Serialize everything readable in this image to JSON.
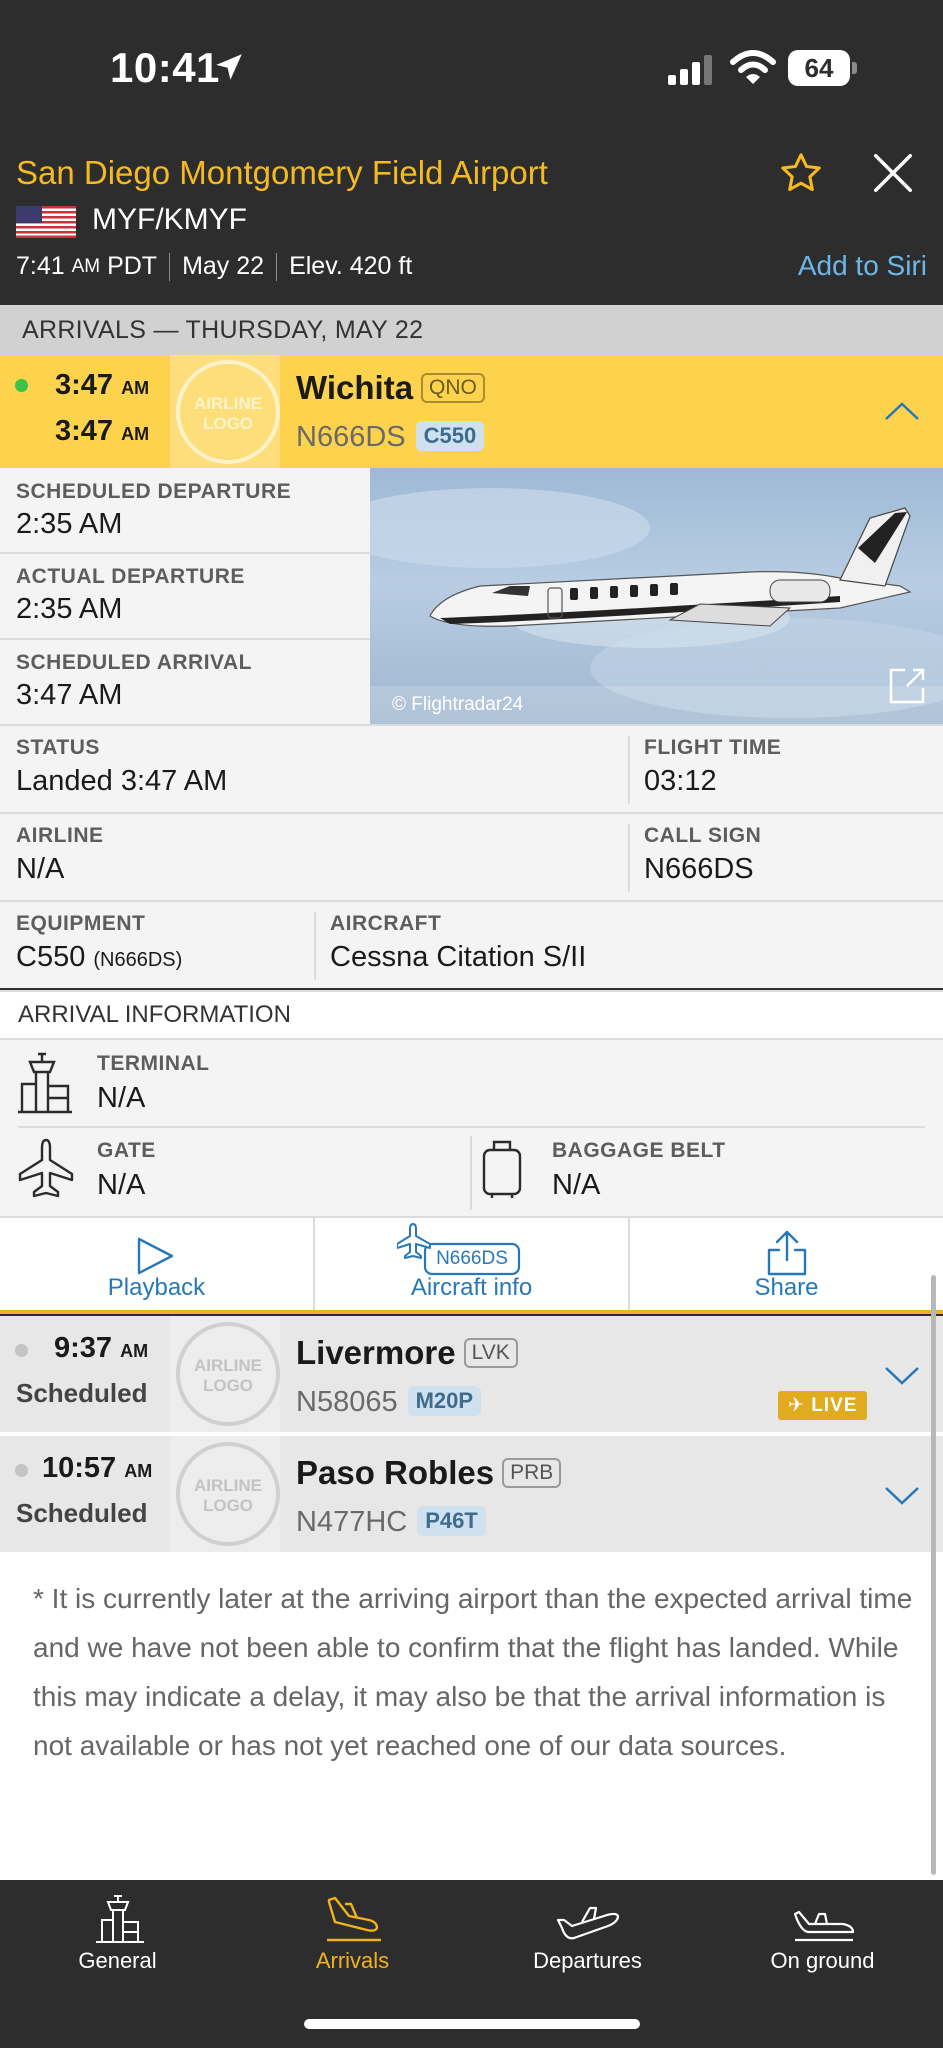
{
  "status_bar": {
    "time": "10:41",
    "battery": "64"
  },
  "airport": {
    "name": "San Diego Montgomery Field Airport",
    "codes": "MYF/KMYF",
    "local_time": "7:41",
    "local_ampm": "AM",
    "timezone": "PDT",
    "date": "May 22",
    "elevation": "Elev. 420 ft",
    "add_to_siri": "Add to Siri"
  },
  "section": {
    "title": "ARRIVALS — THURSDAY, MAY 22"
  },
  "flights": [
    {
      "time1": "3:47",
      "ampm1": "AM",
      "time2": "3:47",
      "ampm2": "AM",
      "logo": "AIRLINE LOGO",
      "origin": "Wichita",
      "origin_code": "QNO",
      "registration": "N666DS",
      "aircraft_type": "C550",
      "dot_color": "#3cc34a"
    },
    {
      "time": "9:37",
      "ampm": "AM",
      "status": "Scheduled",
      "logo": "AIRLINE LOGO",
      "origin": "Livermore",
      "origin_code": "LVK",
      "registration": "N58065",
      "aircraft_type": "M20P",
      "live": "LIVE"
    },
    {
      "time": "10:57",
      "ampm": "AM",
      "status": "Scheduled",
      "logo": "AIRLINE LOGO",
      "origin": "Paso Robles",
      "origin_code": "PRB",
      "registration": "N477HC",
      "aircraft_type": "P46T"
    }
  ],
  "details": {
    "sched_dep_label": "SCHEDULED DEPARTURE",
    "sched_dep": "2:35 AM",
    "actual_dep_label": "ACTUAL DEPARTURE",
    "actual_dep": "2:35 AM",
    "sched_arr_label": "SCHEDULED ARRIVAL",
    "sched_arr": "3:47 AM",
    "photo_credit": "© Flightradar24",
    "status_label": "STATUS",
    "status": "Landed 3:47 AM",
    "flight_time_label": "FLIGHT TIME",
    "flight_time": "03:12",
    "airline_label": "AIRLINE",
    "airline": "N/A",
    "call_sign_label": "CALL SIGN",
    "call_sign": "N666DS",
    "equipment_label": "EQUIPMENT",
    "equipment": "C550",
    "equipment_reg": "(N666DS)",
    "aircraft_label": "AIRCRAFT",
    "aircraft": "Cessna Citation S/II"
  },
  "arrival_info": {
    "title": "ARRIVAL INFORMATION",
    "terminal_label": "TERMINAL",
    "terminal": "N/A",
    "gate_label": "GATE",
    "gate": "N/A",
    "baggage_label": "BAGGAGE BELT",
    "baggage": "N/A"
  },
  "actions": {
    "playback": "Playback",
    "aircraft_info": "Aircraft info",
    "aircraft_reg": "N666DS",
    "share": "Share"
  },
  "note": "* It is currently later at the arriving airport than the expected arrival time and we have not been able to confirm that the flight has landed. While this may indicate a delay, it may also be that the arrival information is not available or has not yet reached one of our data sources.",
  "tabs": [
    {
      "label": "General"
    },
    {
      "label": "Arrivals",
      "active": true
    },
    {
      "label": "Departures"
    },
    {
      "label": "On ground"
    }
  ],
  "colors": {
    "accent": "#f5b921",
    "link": "#2878b8",
    "active_row": "#fdd34e"
  }
}
